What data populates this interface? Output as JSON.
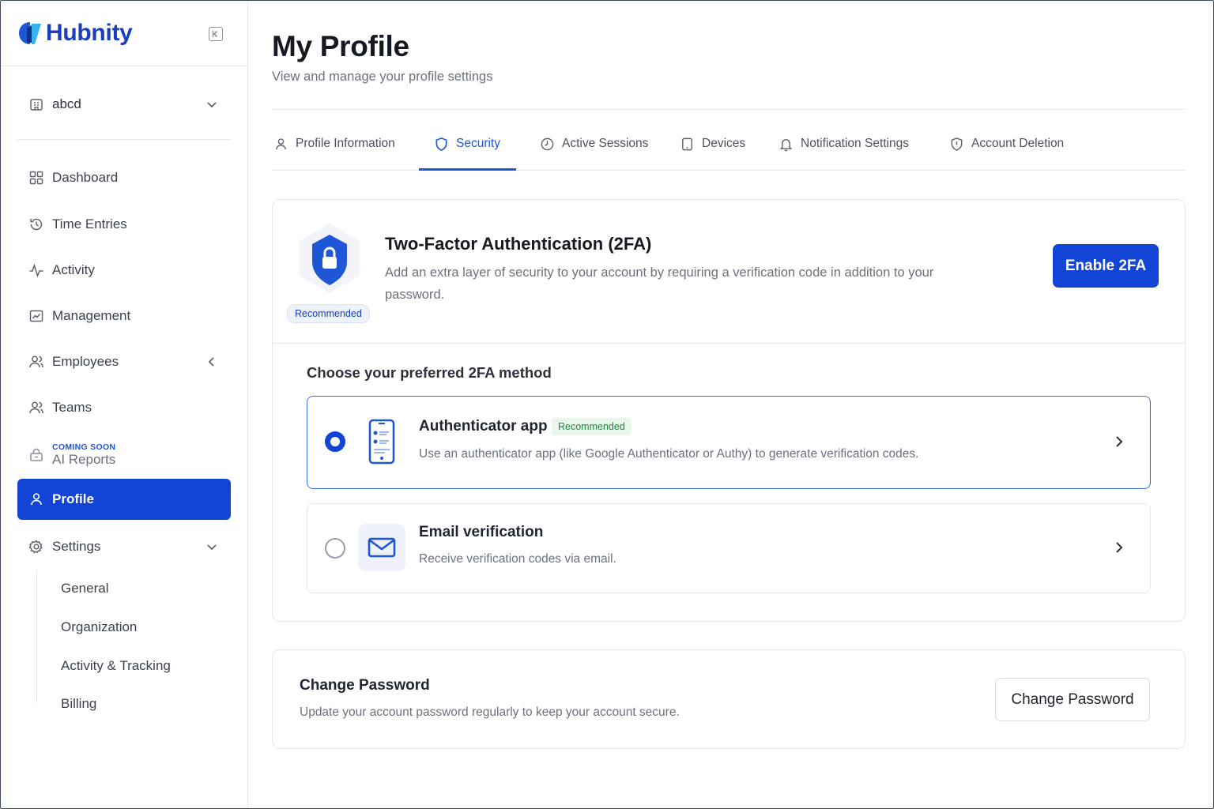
{
  "brand": {
    "name": "Hubnity",
    "color": "#1a3fb8"
  },
  "workspace": {
    "name": "abcd"
  },
  "sidebar": {
    "items": [
      {
        "label": "Dashboard",
        "icon": "grid-icon"
      },
      {
        "label": "Time Entries",
        "icon": "history-icon"
      },
      {
        "label": "Activity",
        "icon": "pulse-icon"
      },
      {
        "label": "Management",
        "icon": "chart-folder-icon"
      },
      {
        "label": "Employees",
        "icon": "users-icon"
      },
      {
        "label": "Teams",
        "icon": "team-icon"
      },
      {
        "label": "AI Reports",
        "badge": "COMING SOON",
        "icon": "lock-box-icon"
      },
      {
        "label": "Profile",
        "icon": "user-icon",
        "active": true
      },
      {
        "label": "Settings",
        "icon": "gear-icon"
      }
    ],
    "settings_sub": [
      "General",
      "Organization",
      "Activity & Tracking",
      "Billing"
    ]
  },
  "page": {
    "title": "My Profile",
    "subtitle": "View and manage your profile settings"
  },
  "tabs": [
    {
      "label": "Profile Information",
      "icon": "user-icon"
    },
    {
      "label": "Security",
      "icon": "shield-icon",
      "active": true
    },
    {
      "label": "Active Sessions",
      "icon": "clock-icon"
    },
    {
      "label": "Devices",
      "icon": "tablet-icon"
    },
    {
      "label": "Notification Settings",
      "icon": "bell-icon"
    },
    {
      "label": "Account Deletion",
      "icon": "shield-alert-icon"
    }
  ],
  "twofa": {
    "badge": "Recommended",
    "title": "Two-Factor Authentication (2FA)",
    "description": "Add an extra layer of security to your account by requiring a verification code in addition to your password.",
    "enable_label": "Enable 2FA",
    "choose_title": "Choose your preferred 2FA method",
    "methods": [
      {
        "title": "Authenticator app",
        "badge": "Recommended",
        "description": "Use an authenticator app (like Google Authenticator or Authy) to generate verification codes.",
        "selected": true
      },
      {
        "title": "Email verification",
        "description": "Receive verification codes via email.",
        "selected": false
      }
    ]
  },
  "password": {
    "title": "Change Password",
    "description": "Update your account password regularly to keep your account secure.",
    "button_label": "Change Password"
  },
  "colors": {
    "accent": "#1245d6",
    "success": "#1d8a3c"
  }
}
